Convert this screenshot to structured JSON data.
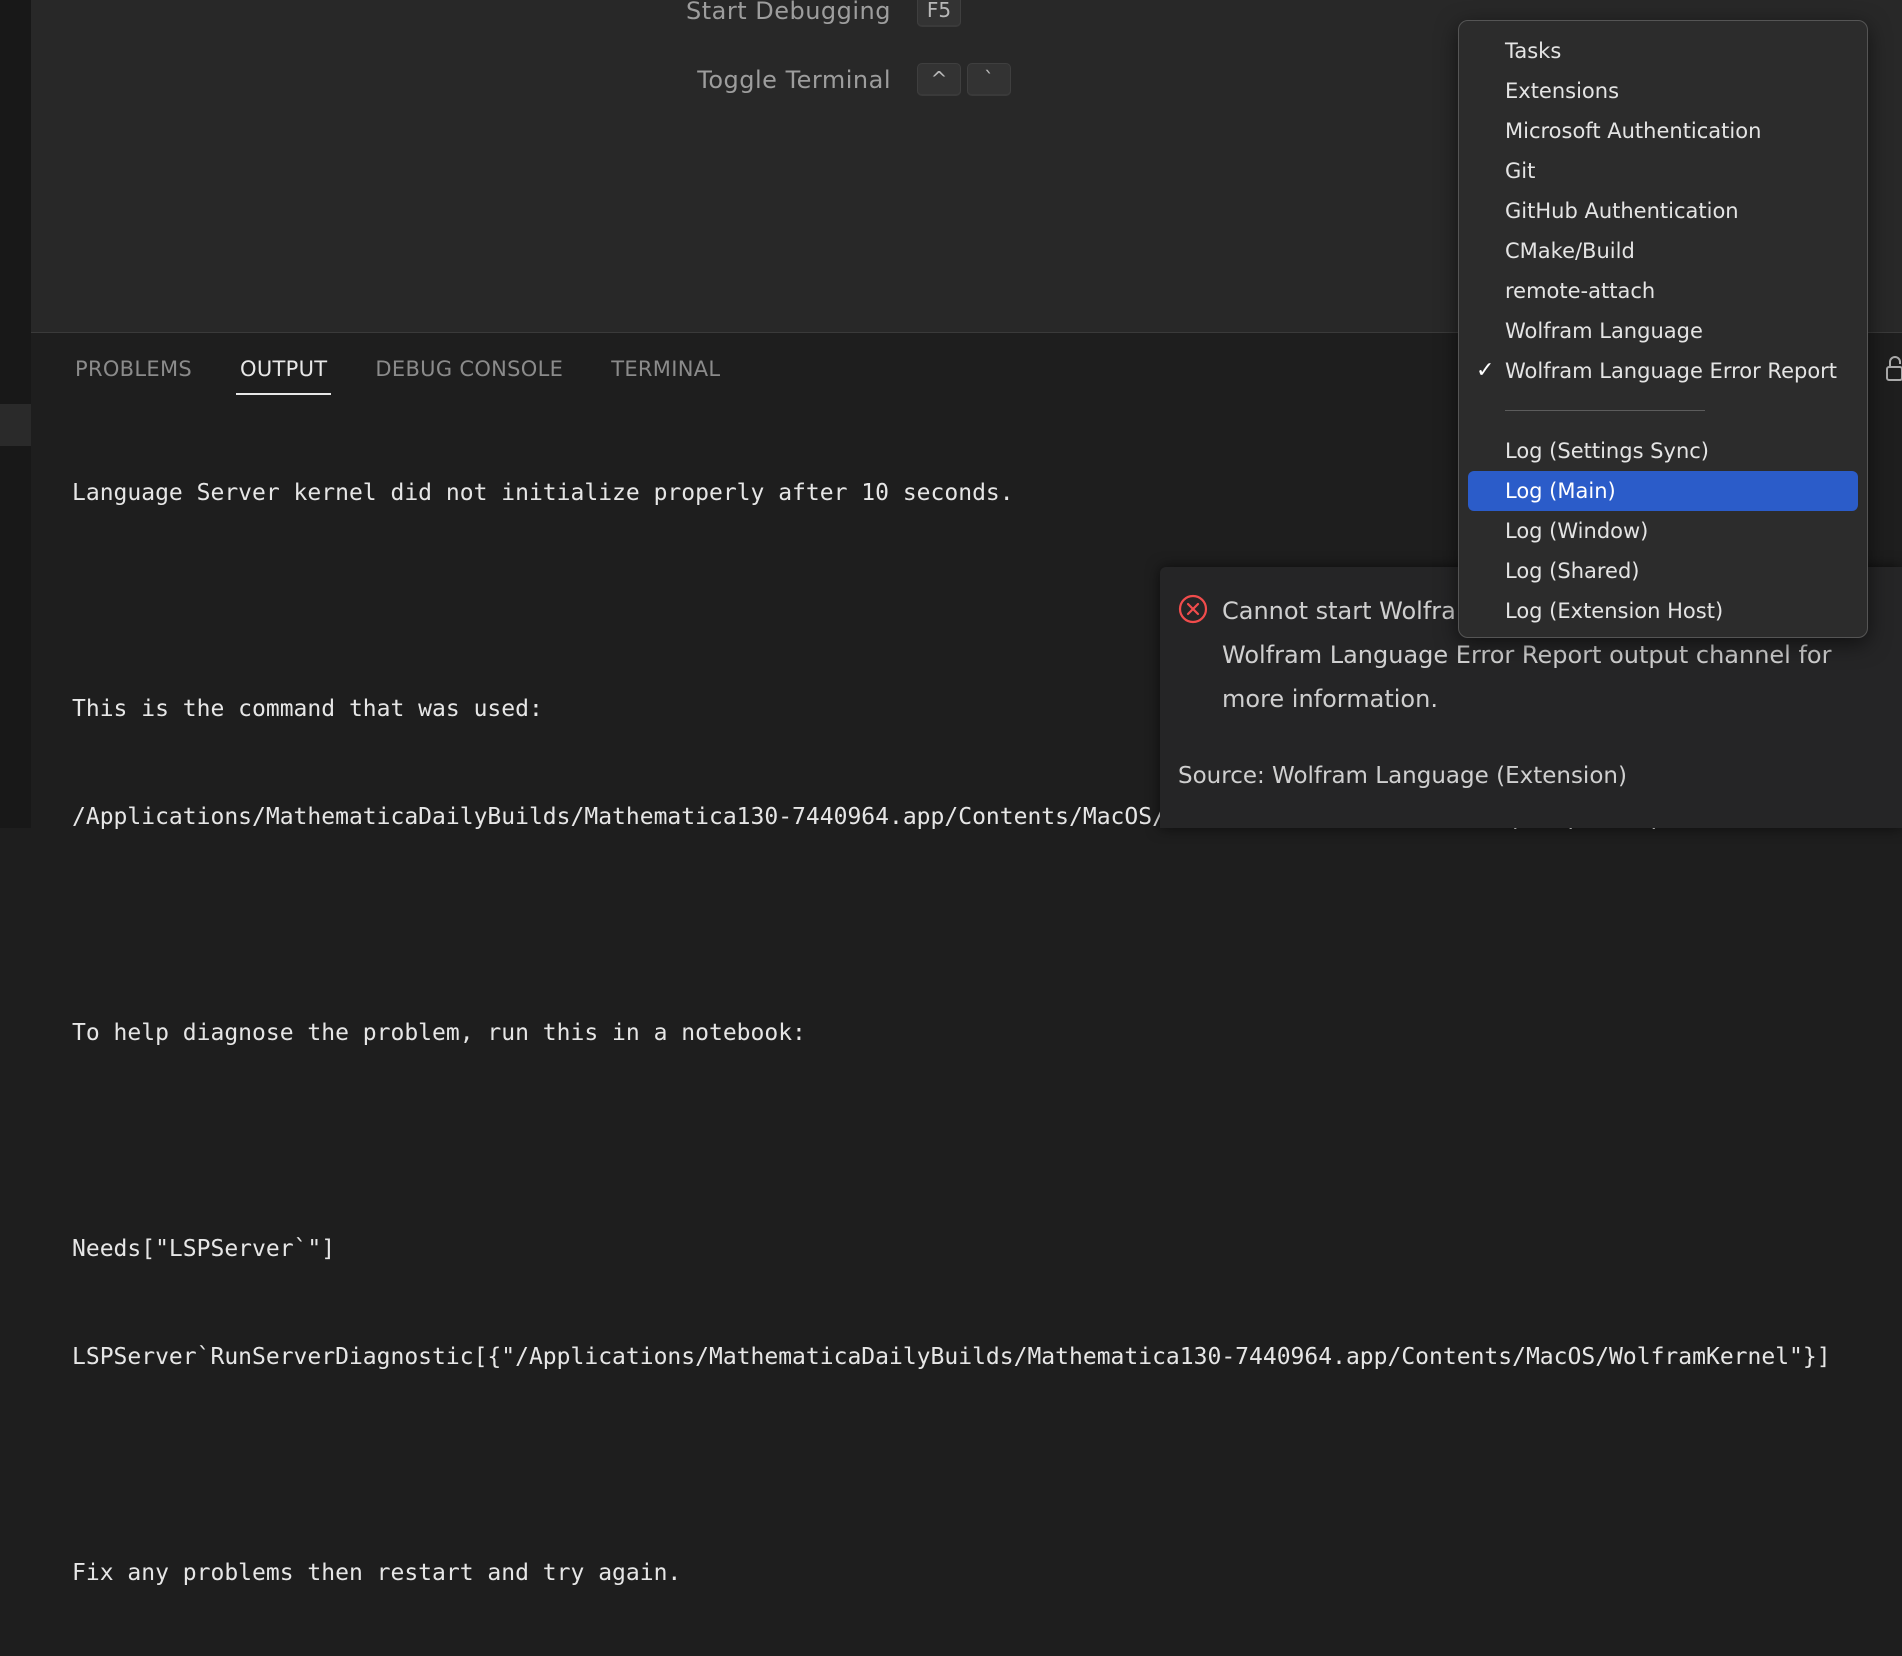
{
  "editor": {
    "shortcuts": [
      {
        "label": "Start Debugging",
        "keys": [
          "F5"
        ]
      },
      {
        "label": "Toggle Terminal",
        "keys": [
          "^",
          "`"
        ]
      }
    ]
  },
  "panel": {
    "tabs": [
      {
        "label": "PROBLEMS",
        "active": false
      },
      {
        "label": "OUTPUT",
        "active": true
      },
      {
        "label": "DEBUG CONSOLE",
        "active": false
      },
      {
        "label": "TERMINAL",
        "active": false
      }
    ],
    "output_lines": [
      "Language Server kernel did not initialize properly after 10 seconds.",
      "",
      "This is the command that was used:",
      "/Applications/MathematicaDailyBuilds/Mathematica130-7440964.app/Contents/MacOS/WolframKernel,-noinit,-noprompt,-nopaclet,-nostartuppaclets,-noicon,-run,Needs[\"LSPServer`\"];LSPServer`StartServer[]",
      "",
      "To help diagnose the problem, run this in a notebook:",
      "",
      "Needs[\"LSPServer`\"]",
      "LSPServer`RunServerDiagnostic[{\"/Applications/MathematicaDailyBuilds/Mathematica130-7440964.app/Contents/MacOS/WolframKernel\"}]",
      "",
      "Fix any problems then restart and try again."
    ]
  },
  "notification": {
    "icon": "error-circle-icon",
    "message_lines": [
      "Cannot start Wolfram Language server. Check the",
      "Wolfram Language Error Report output channel for",
      "more information."
    ],
    "source": "Source: Wolfram Language (Extension)"
  },
  "output_channel_dropdown": {
    "items": [
      {
        "label": "Tasks"
      },
      {
        "label": "Extensions"
      },
      {
        "label": "Microsoft Authentication"
      },
      {
        "label": "Git"
      },
      {
        "label": "GitHub Authentication"
      },
      {
        "label": "CMake/Build"
      },
      {
        "label": "remote-attach"
      },
      {
        "label": "Wolfram Language"
      },
      {
        "label": "Wolfram Language Error Report",
        "checked": true
      },
      {
        "label": "Log (Settings Sync)"
      },
      {
        "label": "Log (Main)",
        "highlighted": true
      },
      {
        "label": "Log (Window)"
      },
      {
        "label": "Log (Shared)"
      },
      {
        "label": "Log (Extension Host)"
      }
    ],
    "check_glyph": "✓"
  },
  "colors": {
    "selection": "#2b5cc9",
    "error": "#f14c4c"
  }
}
